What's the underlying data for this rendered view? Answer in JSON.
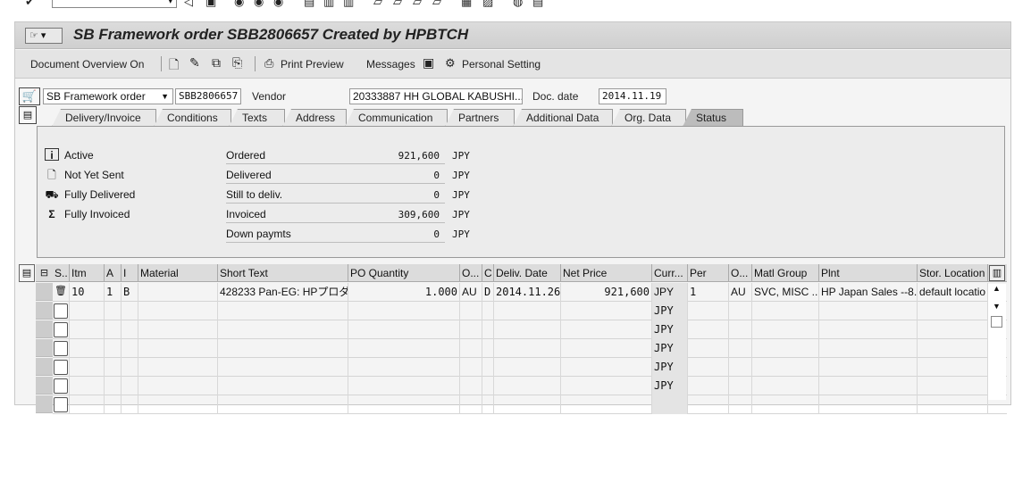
{
  "header": {
    "title": "SB Framework order SBB2806657 Created by HPBTCH",
    "doc_type": "SB Framework order",
    "doc_number": "SBB2806657",
    "vendor_label": "Vendor",
    "vendor_value": "20333887 HH GLOBAL KABUSHI...",
    "doc_date_label": "Doc. date",
    "doc_date": "2014.11.19"
  },
  "toolbar": {
    "doc_overview": "Document Overview On",
    "print_preview": "Print Preview",
    "messages": "Messages",
    "personal_setting": "Personal Setting"
  },
  "tabs": [
    "Delivery/Invoice",
    "Conditions",
    "Texts",
    "Address",
    "Communication",
    "Partners",
    "Additional Data",
    "Org. Data",
    "Status"
  ],
  "status": {
    "flags": [
      "Active",
      "Not Yet Sent",
      "Fully Delivered",
      "Fully Invoiced"
    ],
    "values": [
      {
        "label": "Ordered",
        "value": "921,600",
        "currency": "JPY"
      },
      {
        "label": "Delivered",
        "value": "0",
        "currency": "JPY"
      },
      {
        "label": "Still to deliv.",
        "value": "0",
        "currency": "JPY"
      },
      {
        "label": "Invoiced",
        "value": "309,600",
        "currency": "JPY"
      },
      {
        "label": "Down paymts",
        "value": "0",
        "currency": "JPY"
      }
    ]
  },
  "items": {
    "columns": [
      "S..",
      "Itm",
      "A",
      "I",
      "Material",
      "Short Text",
      "PO Quantity",
      "O...",
      "C",
      "Deliv. Date",
      "Net Price",
      "Curr...",
      "Per",
      "O...",
      "Matl Group",
      "Plnt",
      "Stor. Location"
    ],
    "rows": [
      {
        "itm": "10",
        "a": "1",
        "i": "B",
        "material": "",
        "short_text": "428233 Pan-EG: HPプロダ...",
        "qty": "1.000",
        "ou": "AU",
        "c": "D",
        "deliv": "2014.11.26",
        "price": "921,600",
        "curr": "JPY",
        "per": "1",
        "opu": "AU",
        "matl_group": "SVC, MISC ...",
        "plnt": "HP Japan Sales --8...",
        "stor": "default locatio"
      }
    ],
    "empty_curr": "JPY"
  }
}
